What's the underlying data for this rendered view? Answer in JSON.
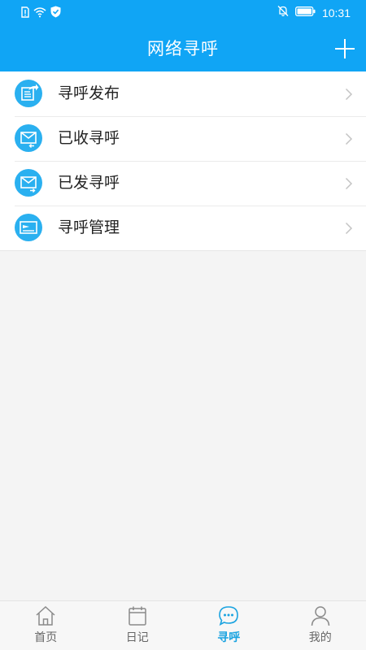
{
  "status_bar": {
    "time": "10:31",
    "left_icons": [
      "sim-alert-icon",
      "wifi-icon",
      "shield-check-icon"
    ],
    "right_icons": [
      "notifications-muted-icon",
      "battery-icon"
    ]
  },
  "header": {
    "title": "网络寻呼",
    "action_icon": "plus-icon"
  },
  "menu": {
    "items": [
      {
        "label": "寻呼发布",
        "icon": "publish-icon"
      },
      {
        "label": "已收寻呼",
        "icon": "inbox-mail-icon"
      },
      {
        "label": "已发寻呼",
        "icon": "sent-mail-icon"
      },
      {
        "label": "寻呼管理",
        "icon": "manage-icon"
      }
    ]
  },
  "bottom_nav": {
    "items": [
      {
        "label": "首页",
        "icon": "home-icon",
        "active": false
      },
      {
        "label": "日记",
        "icon": "calendar-icon",
        "active": false
      },
      {
        "label": "寻呼",
        "icon": "chat-bubble-icon",
        "active": true
      },
      {
        "label": "我的",
        "icon": "person-icon",
        "active": false
      }
    ]
  },
  "colors": {
    "primary": "#10a5f5",
    "icon_circle": "#2ab0f0",
    "active_tab": "#1aa3e0",
    "inactive_tab": "#666666",
    "background": "#f4f4f4"
  }
}
